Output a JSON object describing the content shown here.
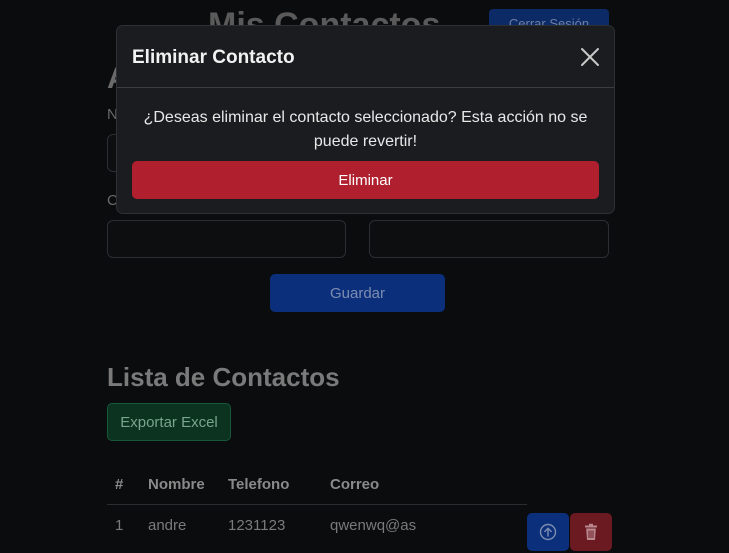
{
  "header": {
    "title": "Mis Contactos",
    "logout_label": "Cerrar Sesión"
  },
  "form": {
    "heading": "Agregar Contacto",
    "name_label": "Nombre",
    "email_label": "Correo",
    "save_label": "Guardar"
  },
  "list": {
    "heading": "Lista de Contactos",
    "export_label": "Exportar Excel",
    "columns": [
      "#",
      "Nombre",
      "Telefono",
      "Correo"
    ],
    "rows": [
      {
        "num": "1",
        "name": "andre",
        "phone": "1231123",
        "email": "qwenwq@as"
      }
    ]
  },
  "modal": {
    "title": "Eliminar Contacto",
    "message": "¿Deseas eliminar el contacto seleccionado? Esta acción no se puede revertir!",
    "confirm_label": "Eliminar",
    "close_icon": "close-icon"
  },
  "colors": {
    "danger": "#b01f2e",
    "primary": "#0b2f7a",
    "success": "#0c3220",
    "modal_bg": "#1a1c1f",
    "page_bg": "#0b0c0d"
  }
}
